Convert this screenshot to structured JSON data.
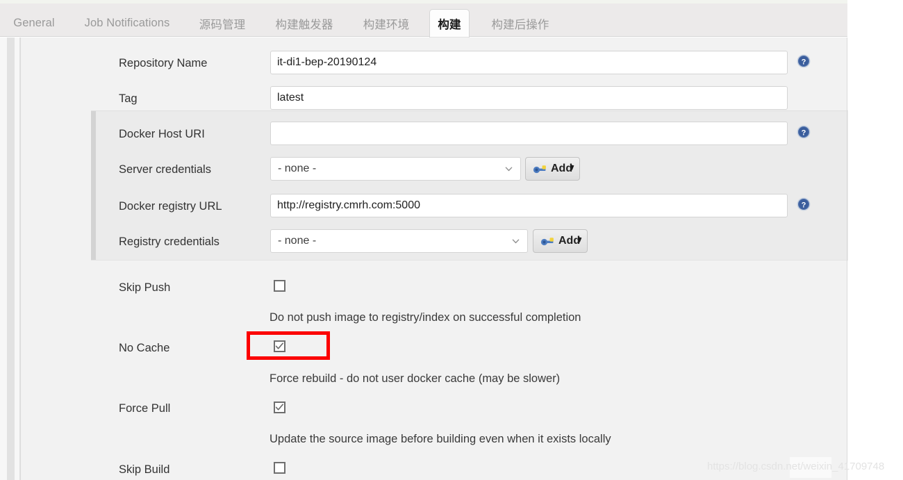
{
  "tabs": [
    {
      "label": "General",
      "active": false
    },
    {
      "label": "Job Notifications",
      "active": false
    },
    {
      "label": "源码管理",
      "active": false
    },
    {
      "label": "构建触发器",
      "active": false
    },
    {
      "label": "构建环境",
      "active": false
    },
    {
      "label": "构建",
      "active": true
    },
    {
      "label": "构建后操作",
      "active": false
    }
  ],
  "form": {
    "repository_name": {
      "label": "Repository Name",
      "value": "it-di1-bep-20190124",
      "placeholder": "",
      "help_icon": "help-icon"
    },
    "tag": {
      "label": "Tag",
      "value": "latest",
      "placeholder": ""
    },
    "docker_host_uri": {
      "label": "Docker Host URI",
      "value": "",
      "placeholder": "",
      "help_icon": "help-icon"
    },
    "server_credentials": {
      "label": "Server credentials",
      "value": "- none -",
      "options": [
        "- none -"
      ],
      "add_button": "Add",
      "add_icon": "key-icon"
    },
    "docker_registry_url": {
      "label": "Docker registry URL",
      "value": "http://registry.cmrh.com:5000",
      "placeholder": "",
      "help_icon": "help-icon"
    },
    "registry_credentials": {
      "label": "Registry credentials",
      "value": "- none -",
      "options": [
        "- none -"
      ],
      "add_button": "Add",
      "add_icon": "key-icon"
    },
    "skip_push": {
      "label": "Skip Push",
      "checked": false,
      "description": "Do not push image to registry/index on successful completion"
    },
    "no_cache": {
      "label": "No Cache",
      "checked": true,
      "description": "Force rebuild - do not user docker cache (may be slower)",
      "highlighted": true,
      "highlight_color": "#fc0000"
    },
    "force_pull": {
      "label": "Force Pull",
      "checked": true,
      "description": "Update the source image before building even when it exists locally"
    },
    "skip_build": {
      "label": "Skip Build",
      "checked": false,
      "description": ""
    }
  },
  "watermark": {
    "text": "https://blog.csdn.net/weixin_41709748"
  }
}
